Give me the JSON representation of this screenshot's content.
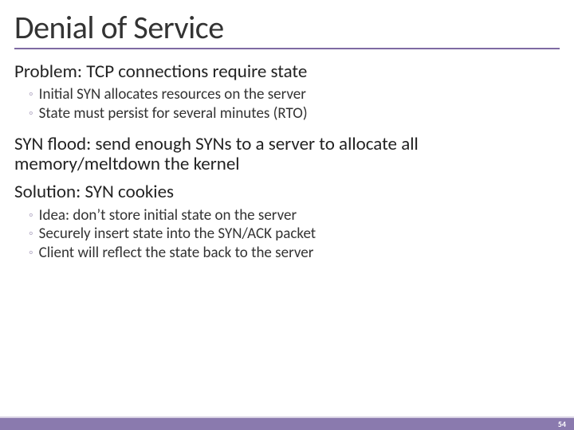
{
  "title": "Denial of Service",
  "blocks": [
    {
      "text": "Problem: TCP connections require state",
      "subs": [
        "Initial SYN allocates resources on the server",
        "State must persist for several minutes (RTO)"
      ]
    },
    {
      "text": "SYN flood: send enough SYNs to a server to allocate all memory/meltdown the kernel",
      "subs": []
    },
    {
      "text": "Solution: SYN cookies",
      "subs": [
        "Idea: don’t store initial state on the server",
        "Securely insert state into the SYN/ACK packet",
        "Client will reflect the state back to the server"
      ]
    }
  ],
  "page_number": "54",
  "colors": {
    "accent": "#7e6aa3",
    "footer": "#8a7aae"
  }
}
